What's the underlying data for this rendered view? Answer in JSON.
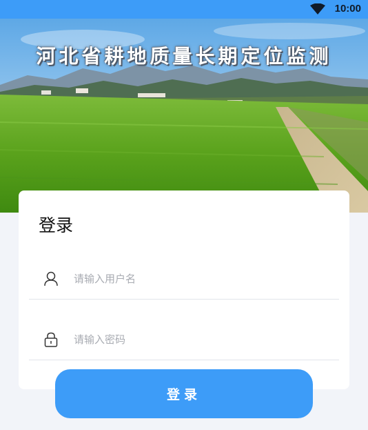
{
  "status_bar": {
    "time": "10:00",
    "wifi_icon": "wifi-icon"
  },
  "banner": {
    "title": "河北省耕地质量长期定位监测"
  },
  "login": {
    "title": "登录",
    "username": {
      "icon": "user-icon",
      "value": "",
      "placeholder": "请输入用户名"
    },
    "password": {
      "icon": "lock-icon",
      "value": "",
      "placeholder": "请输入密码"
    },
    "button_label": "登录"
  },
  "colors": {
    "primary": "#3d9cf8",
    "background": "#f2f4f9",
    "card": "#ffffff"
  }
}
